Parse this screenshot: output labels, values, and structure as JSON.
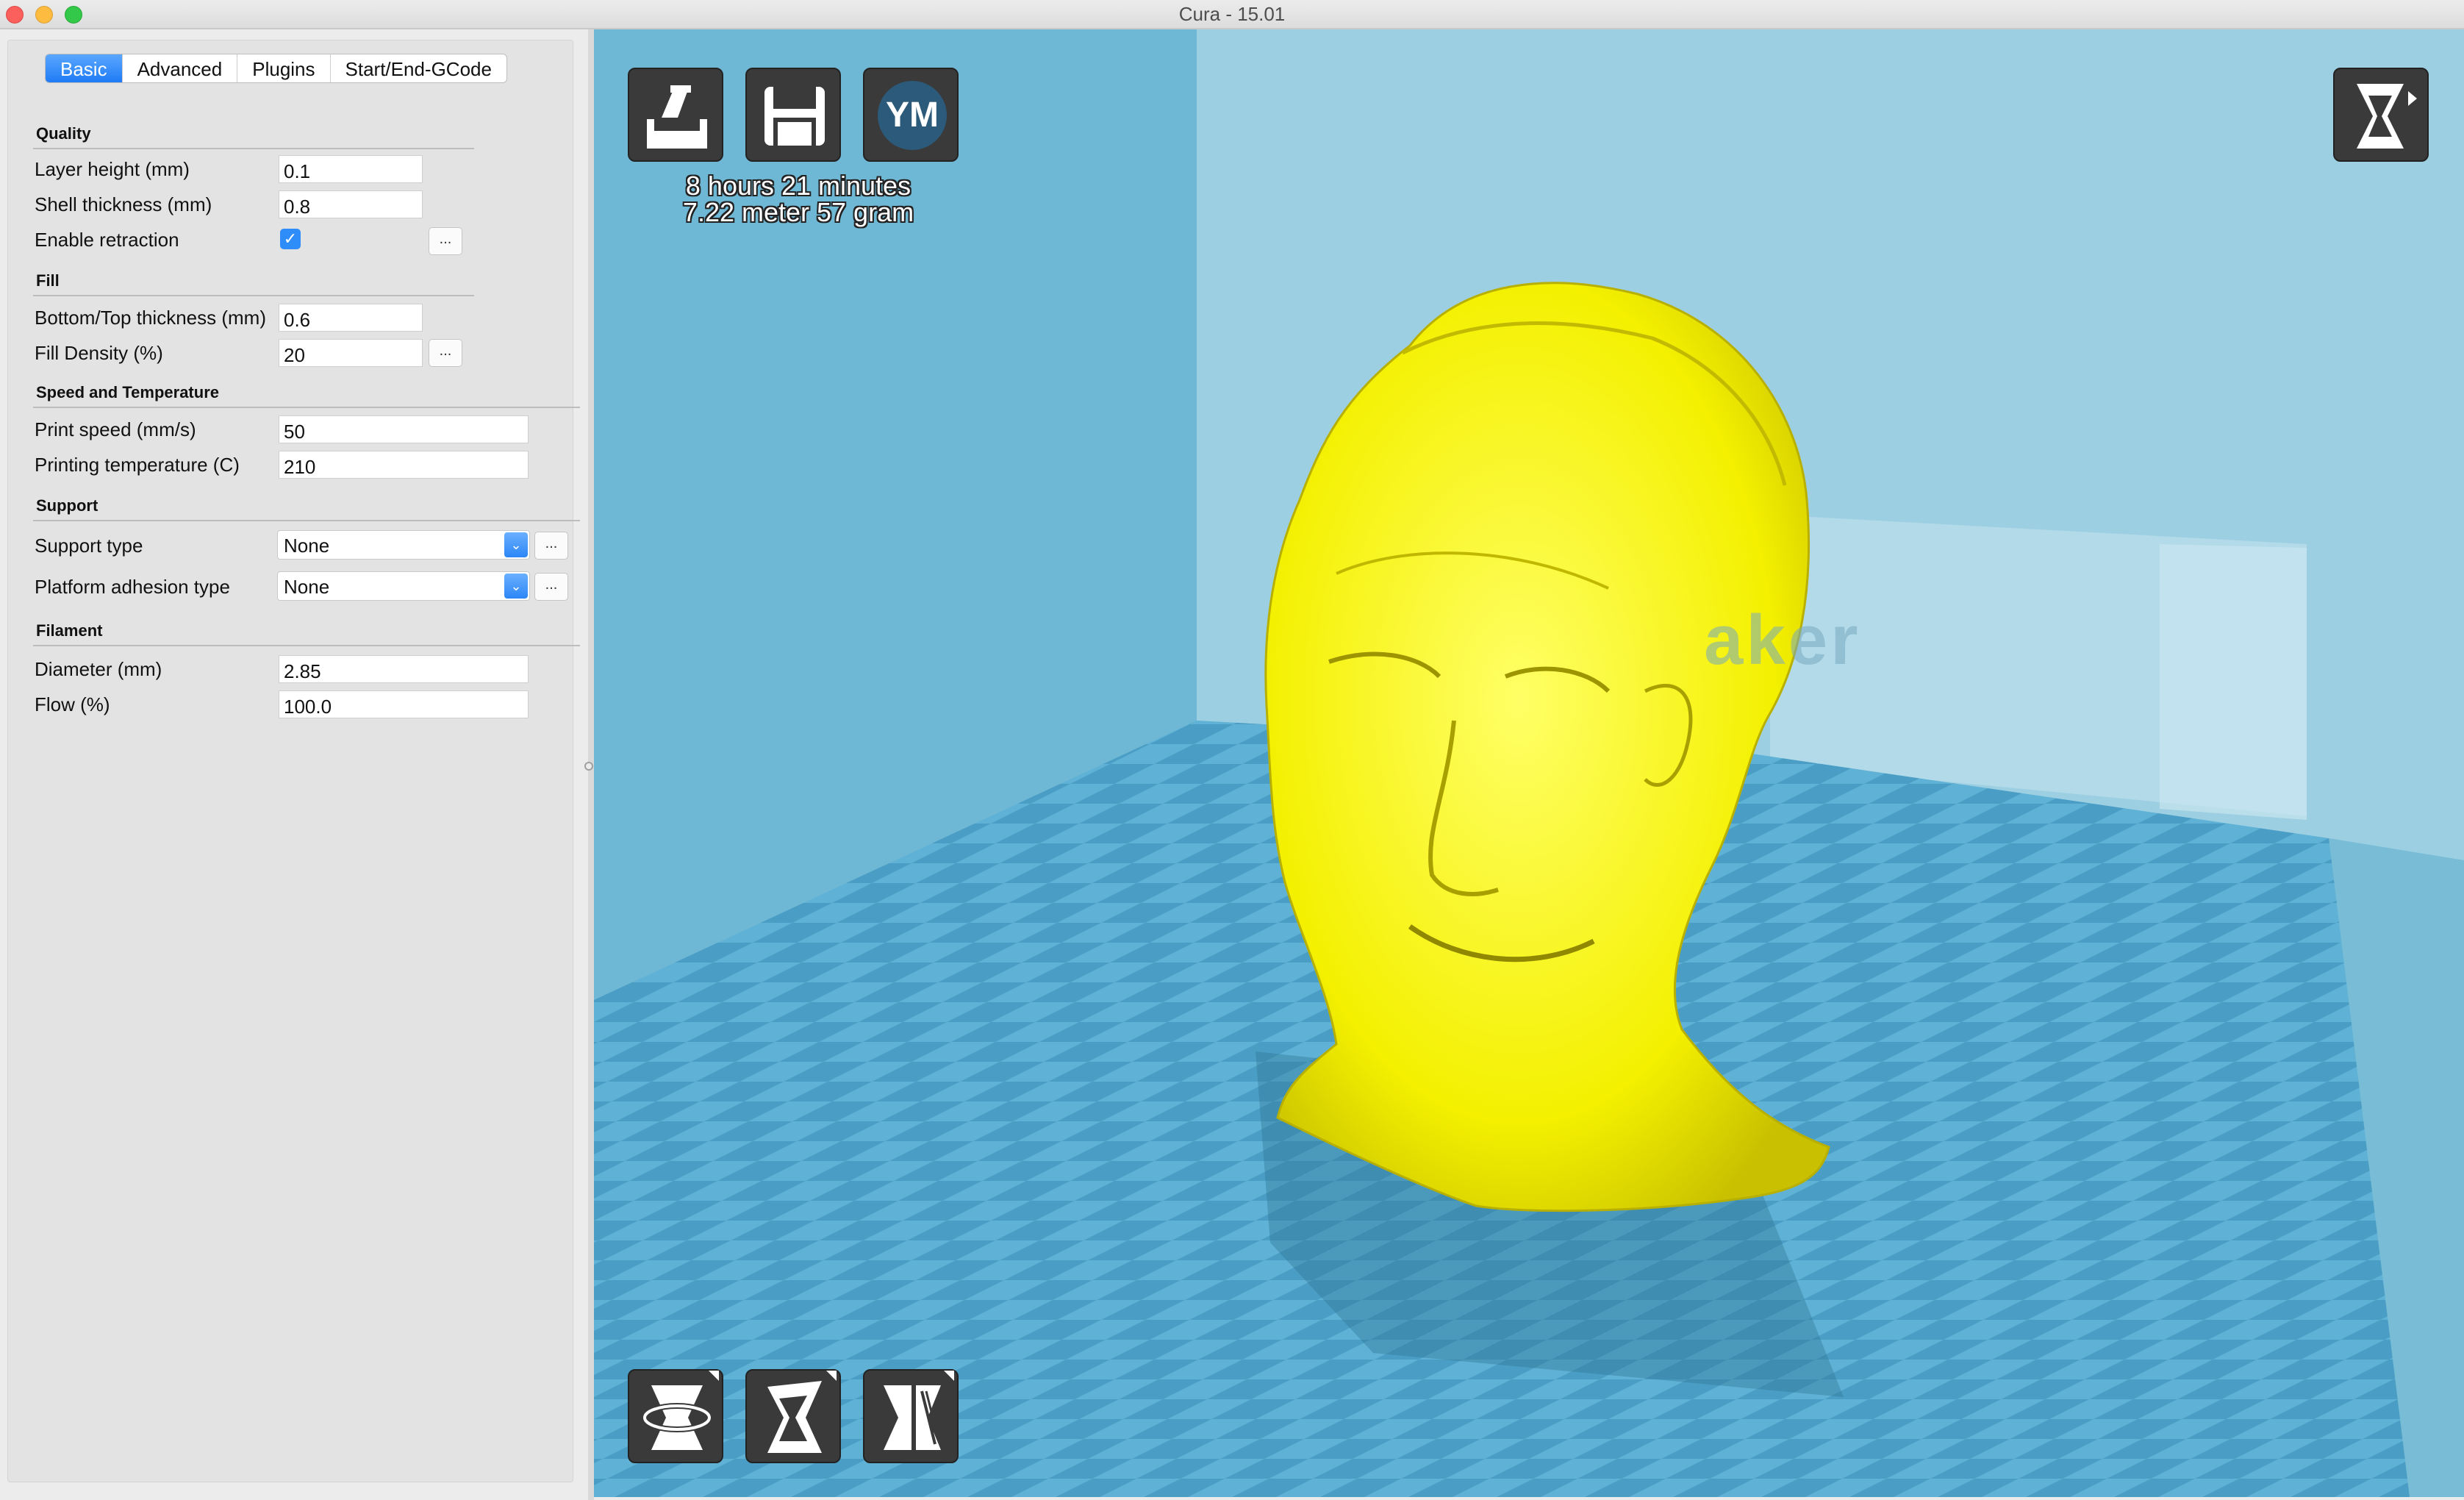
{
  "window": {
    "title": "Cura - 15.01"
  },
  "tabs": [
    "Basic",
    "Advanced",
    "Plugins",
    "Start/End-GCode"
  ],
  "sections": {
    "quality": {
      "title": "Quality",
      "layer_height_label": "Layer height (mm)",
      "layer_height_value": "0.1",
      "shell_thickness_label": "Shell thickness (mm)",
      "shell_thickness_value": "0.8",
      "enable_retraction_label": "Enable retraction",
      "enable_retraction_checked": true
    },
    "fill": {
      "title": "Fill",
      "bottom_top_label": "Bottom/Top thickness (mm)",
      "bottom_top_value": "0.6",
      "fill_density_label": "Fill Density (%)",
      "fill_density_value": "20"
    },
    "speed": {
      "title": "Speed and Temperature",
      "print_speed_label": "Print speed (mm/s)",
      "print_speed_value": "50",
      "print_temp_label": "Printing temperature (C)",
      "print_temp_value": "210"
    },
    "support": {
      "title": "Support",
      "support_type_label": "Support type",
      "support_type_value": "None",
      "adhesion_label": "Platform adhesion type",
      "adhesion_value": "None"
    },
    "filament": {
      "title": "Filament",
      "diameter_label": "Diameter (mm)",
      "diameter_value": "2.85",
      "flow_label": "Flow (%)",
      "flow_value": "100.0"
    }
  },
  "dots_label": "...",
  "checkmark": "✓",
  "select_arrow": "⌄",
  "viewport": {
    "print_time": "8 hours 21 minutes",
    "print_material": "7.22 meter 57 gram",
    "ym_label": "YM",
    "brand_text": "aker",
    "model_color": "#ffff33",
    "background_color": "#7fc3dc",
    "top_tools": [
      "load-icon",
      "save-icon",
      "youmagine-icon"
    ],
    "bottom_tools": [
      "rotate-icon",
      "scale-icon",
      "mirror-icon"
    ],
    "view_mode_icon": "view-mode-icon"
  }
}
